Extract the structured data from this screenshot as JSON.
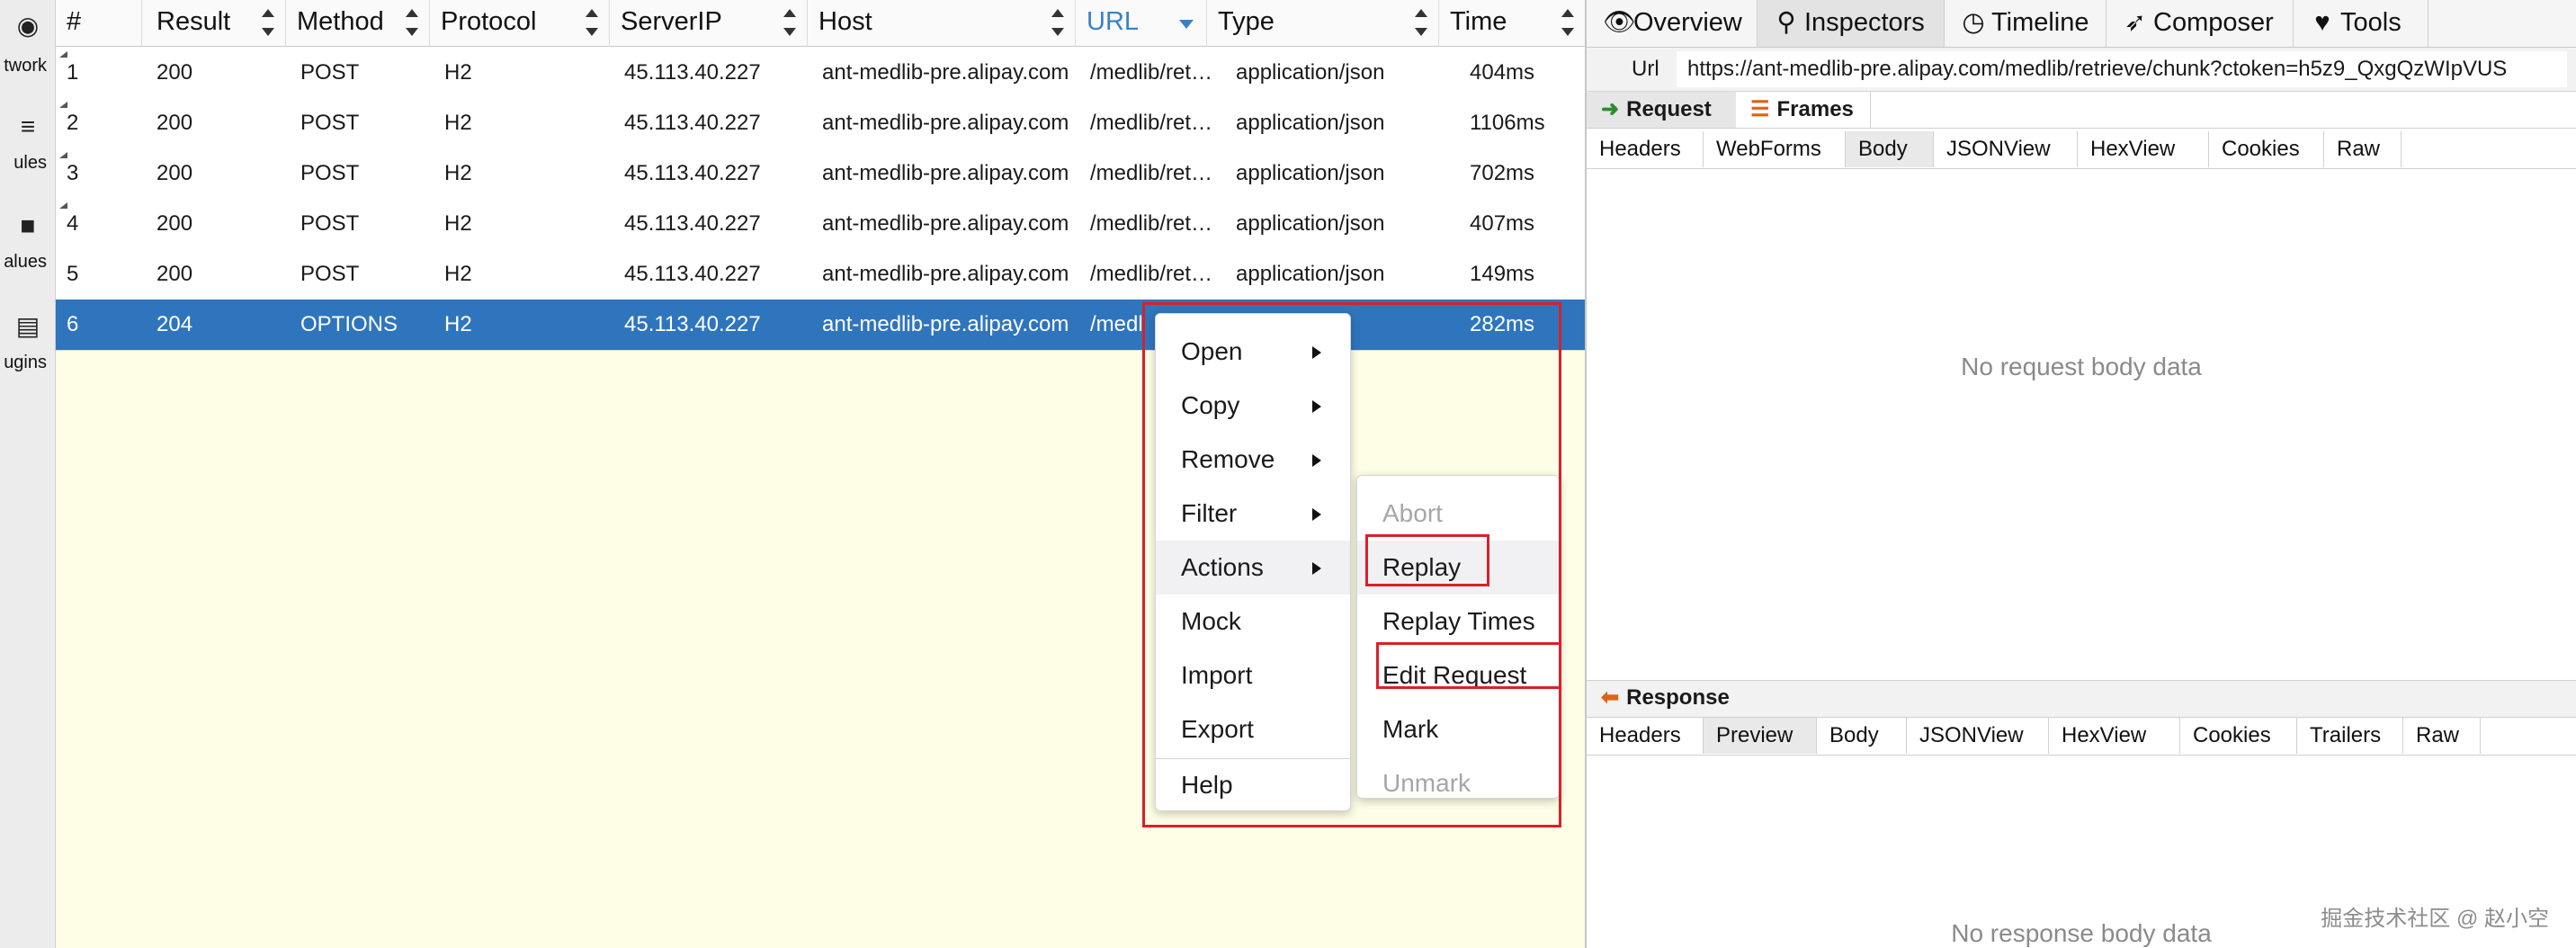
{
  "rail": {
    "items": [
      {
        "icon": "globe-icon",
        "glyph": "◉",
        "label": "twork"
      },
      {
        "icon": "list-icon",
        "glyph": "≡",
        "label": "ules"
      },
      {
        "icon": "folder-icon",
        "glyph": "■",
        "label": "alues"
      },
      {
        "icon": "plugin-list-icon",
        "glyph": "▤",
        "label": "ugins"
      }
    ]
  },
  "table": {
    "columns": {
      "num": "#",
      "result": "Result",
      "method": "Method",
      "protocol": "Protocol",
      "serverip": "ServerIP",
      "host": "Host",
      "url": "URL",
      "type": "Type",
      "time": "Time"
    },
    "sorted_column": "url",
    "rows": [
      {
        "num": "1",
        "result": "200",
        "method": "POST",
        "protocol": "H2",
        "serverip": "45.113.40.227",
        "host": "ant-medlib-pre.alipay.com",
        "url": "/medlib/ret…",
        "type": "application/json",
        "time": "404ms"
      },
      {
        "num": "2",
        "result": "200",
        "method": "POST",
        "protocol": "H2",
        "serverip": "45.113.40.227",
        "host": "ant-medlib-pre.alipay.com",
        "url": "/medlib/ret…",
        "type": "application/json",
        "time": "1106ms"
      },
      {
        "num": "3",
        "result": "200",
        "method": "POST",
        "protocol": "H2",
        "serverip": "45.113.40.227",
        "host": "ant-medlib-pre.alipay.com",
        "url": "/medlib/ret…",
        "type": "application/json",
        "time": "702ms"
      },
      {
        "num": "4",
        "result": "200",
        "method": "POST",
        "protocol": "H2",
        "serverip": "45.113.40.227",
        "host": "ant-medlib-pre.alipay.com",
        "url": "/medlib/ret…",
        "type": "application/json",
        "time": "407ms"
      },
      {
        "num": "5",
        "result": "200",
        "method": "POST",
        "protocol": "H2",
        "serverip": "45.113.40.227",
        "host": "ant-medlib-pre.alipay.com",
        "url": "/medlib/ret…",
        "type": "application/json",
        "time": "149ms"
      },
      {
        "num": "6",
        "result": "204",
        "method": "OPTIONS",
        "protocol": "H2",
        "serverip": "45.113.40.227",
        "host": "ant-medlib-pre.alipay.com",
        "url": "/medl",
        "type": "",
        "time": "282ms",
        "selected": true
      }
    ]
  },
  "context_menu": {
    "items": [
      "Open",
      "Copy",
      "Remove",
      "Filter",
      "Actions",
      "Mock",
      "Import",
      "Export",
      "Help"
    ]
  },
  "actions_submenu": {
    "items": [
      "Abort",
      "Replay",
      "Replay Times",
      "Edit Request",
      "Mark",
      "Unmark"
    ]
  },
  "right_panel": {
    "tabs": [
      {
        "icon": "eye-icon",
        "glyph": "👁",
        "label": "Overview"
      },
      {
        "icon": "magnifier-icon",
        "glyph": "⚲",
        "label": "Inspectors"
      },
      {
        "icon": "clock-icon",
        "glyph": "◷",
        "label": "Timeline"
      },
      {
        "icon": "paper-plane-icon",
        "glyph": "➶",
        "label": "Composer"
      },
      {
        "icon": "heart-icon",
        "glyph": "♥",
        "label": "Tools"
      }
    ],
    "url_label": "Url",
    "url_value": "https://ant-medlib-pre.alipay.com/medlib/retrieve/chunk?ctoken=h5z9_QxgQzWIpVUS",
    "request_label": "Request",
    "frames_label": "Frames",
    "request_tabs": [
      "Headers",
      "WebForms",
      "Body",
      "JSONView",
      "HexView",
      "Cookies",
      "Raw"
    ],
    "request_empty": "No request body data",
    "response_label": "Response",
    "response_tabs": [
      "Headers",
      "Preview",
      "Body",
      "JSONView",
      "HexView",
      "Cookies",
      "Trailers",
      "Raw"
    ],
    "response_empty": "No response body data"
  },
  "colors": {
    "selected_row": "#2f75bd",
    "table_bg": "#fefee6",
    "annotation": "#d9202a",
    "request_arrow": "#2e8b2e",
    "response_arrow": "#e0611a"
  },
  "watermark": "掘金技术社区 @ 赵小空"
}
